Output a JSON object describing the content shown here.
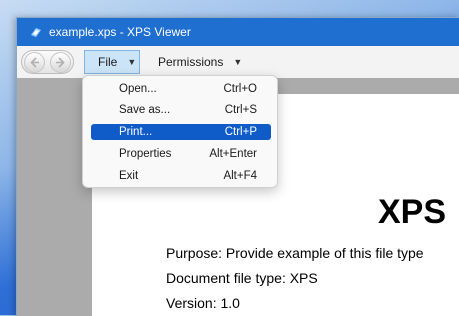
{
  "window": {
    "title": "example.xps - XPS Viewer"
  },
  "toolbar": {
    "file_label": "File",
    "permissions_label": "Permissions"
  },
  "file_menu": {
    "items": [
      {
        "label": "Open...",
        "shortcut": "Ctrl+O"
      },
      {
        "label": "Save as...",
        "shortcut": "Ctrl+S"
      },
      {
        "label": "Print...",
        "shortcut": "Ctrl+P",
        "highlighted": true
      },
      {
        "label": "Properties",
        "shortcut": "Alt+Enter"
      },
      {
        "label": "Exit",
        "shortcut": "Alt+F4"
      }
    ]
  },
  "document": {
    "heading": "XPS",
    "lines": [
      "Purpose: Provide example of this file type",
      "Document file type: XPS",
      "Version: 1.0"
    ]
  },
  "colors": {
    "titlebar": "#1e6fd0",
    "menu_highlight": "#0f5cc9",
    "viewer_background": "#ababab"
  }
}
